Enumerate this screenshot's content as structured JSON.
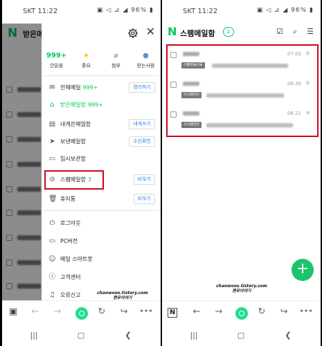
{
  "left": {
    "status_time": "SKT 11:22",
    "status_icons": "▣ ◁ ⊿ ◢ 96% ▮",
    "logo": "N",
    "bg_title": "받은메",
    "quick": [
      {
        "top": "999+",
        "label": "안읽음"
      },
      {
        "top": "★",
        "label": "중요"
      },
      {
        "top": "⌀",
        "label": "첨부"
      },
      {
        "top": "●",
        "label": "받는사람"
      }
    ],
    "menu": {
      "all_label": "전체메일",
      "all_count": "999+",
      "all_action": "정리하기",
      "inbox_label": "받은메일함",
      "inbox_count": "999+",
      "self_label": "내게쓴메일함",
      "self_action": "내게쓰기",
      "sent_label": "보낸메일함",
      "sent_action": "수신확인",
      "temp_label": "임시보관함",
      "spam_label": "스팸메일함",
      "spam_count": "3",
      "spam_action": "비우기",
      "trash_label": "휴지통",
      "trash_action": "비우기",
      "logout_label": "로그아웃",
      "pc_label": "PC버전",
      "smartbot_label": "메일 스마트봇",
      "support_label": "고객센터",
      "report_label": "오류신고"
    },
    "watermark": {
      "line1": "chanwoos.tistory.com",
      "line2": "챈우이야기"
    }
  },
  "right": {
    "status_time": "SKT 11:22",
    "status_icons": "▣ ◁ ⊿ ◢ 96% ▮",
    "logo": "N",
    "title": "스팸메일함",
    "count": "2",
    "mails": [
      {
        "date": "07.02",
        "tag": "스팸자동이동"
      },
      {
        "date": "06.30",
        "tag": "시스템차단"
      },
      {
        "date": "06.21",
        "tag": "시스템차단"
      }
    ],
    "fab": "+",
    "watermark": {
      "line1": "chanwoos.tistory.com",
      "line2": "챈우이야기"
    },
    "nav_n": "N"
  },
  "colors": {
    "brand": "#03c75a",
    "highlight": "#d0021b",
    "fab": "#1bc46b"
  }
}
